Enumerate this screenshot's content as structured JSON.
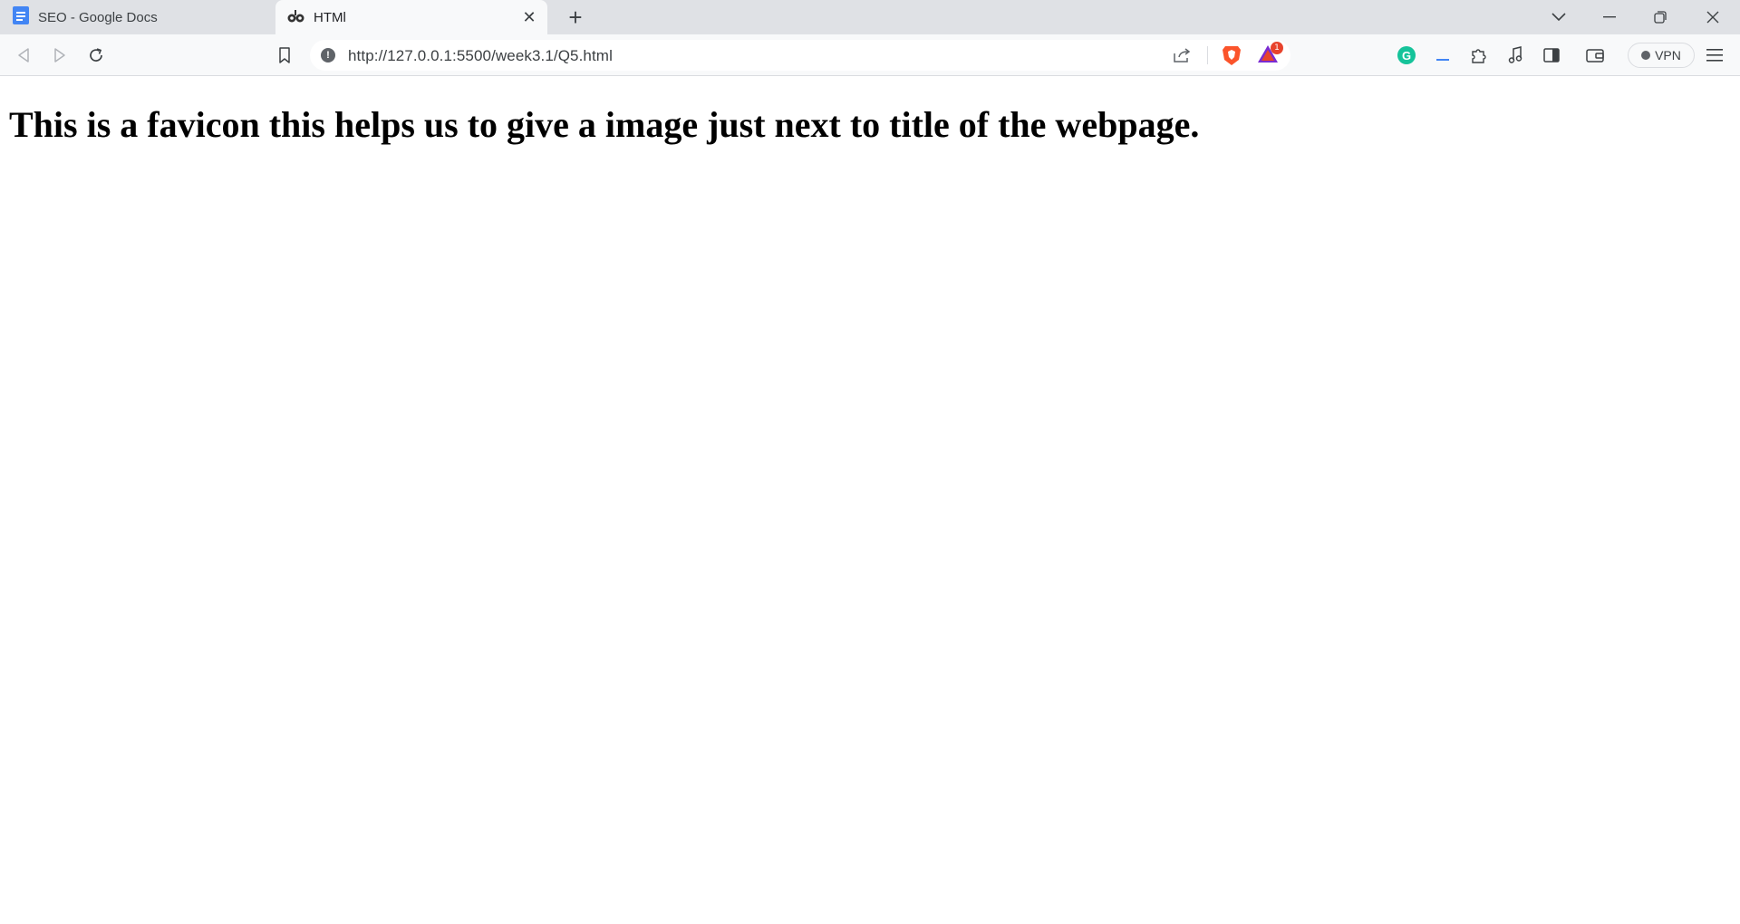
{
  "browser": {
    "tabs": [
      {
        "title": "SEO - Google Docs",
        "icon": "google-docs-icon",
        "active": false
      },
      {
        "title": "HTMl",
        "icon": "favicon-icon",
        "active": true
      }
    ],
    "address_bar": {
      "url": "http://127.0.0.1:5500/week3.1/Q5.html",
      "rewards_badge": "1"
    },
    "vpn_label": "VPN",
    "extension_icons": [
      "grammarly-icon",
      "extension-dash-icon",
      "puzzle-icon",
      "music-icon",
      "sidebar-icon",
      "wallet-icon"
    ],
    "grammarly_letter": "G",
    "colors": {
      "tabstrip": "#dfe1e5",
      "toolbar": "#f8f9fa",
      "docs_blue": "#4285f4",
      "brave_orange": "#fb542b",
      "grammarly_green": "#15c39a"
    }
  },
  "page": {
    "heading": "This is a favicon this helps us to give a image just next to title of the webpage."
  }
}
